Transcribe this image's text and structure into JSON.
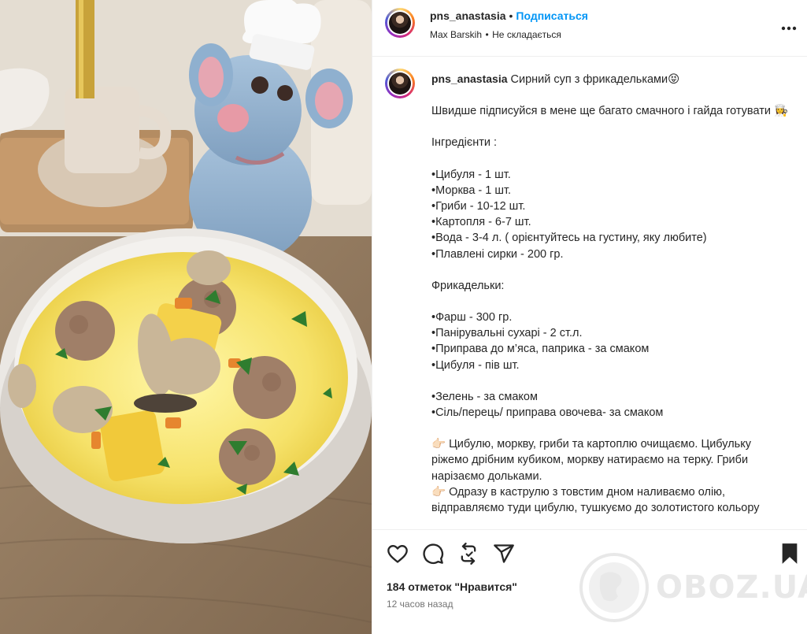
{
  "header": {
    "username": "pns_anastasia",
    "separator": "•",
    "follow_label": "Подписаться",
    "music_artist": "Max Barskih",
    "music_separator": "•",
    "music_track": "Не складається",
    "more_icon": "more-horizontal-icon"
  },
  "caption": {
    "username": "pns_anastasia",
    "title": " Сирний суп з фрикадельками😝",
    "lines": [
      "Швидше підписуйся в мене ще багато смачного і гайда готувати 👩‍🍳",
      "",
      "Інгредієнти :",
      "",
      "•Цибуля - 1 шт.",
      "•Морква - 1 шт.",
      "•Гриби - 10-12 шт.",
      "•Картопля - 6-7 шт.",
      "•Вода - 3-4 л. ( орієнтуйтесь на густину, яку любите)",
      "•Плавлені сирки - 200 гр.",
      "",
      "Фрикадельки:",
      "",
      "•Фарш - 300 гр.",
      "•Панірувальні сухарі - 2 ст.л.",
      "•Приправа до м’яса, паприка - за смаком",
      "•Цибуля - пів шт.",
      "",
      "•Зелень - за смаком",
      "•Сіль/перець/ приправа овочева- за смаком",
      "",
      "👉🏻 Цибулю, моркву, гриби та картоплю очищаємо. Цибульку ріжемо дрібним кубиком, моркву натираємо на терку. Гриби нарізаємо дольками.",
      "👉🏻 Одразу в каструлю з товстим дном наливаємо олію, відправляємо туди цибулю, тушкуємо до золотистого кольору"
    ]
  },
  "actions": {
    "like_icon": "heart-icon",
    "comment_icon": "comment-icon",
    "share_icon": "repost-icon",
    "send_icon": "send-icon",
    "save_icon": "bookmark-icon",
    "likes_text": "184 отметок \"Нравится\"",
    "time_text": "12 часов назад"
  },
  "watermark": {
    "text": "OBOZ.UA"
  }
}
